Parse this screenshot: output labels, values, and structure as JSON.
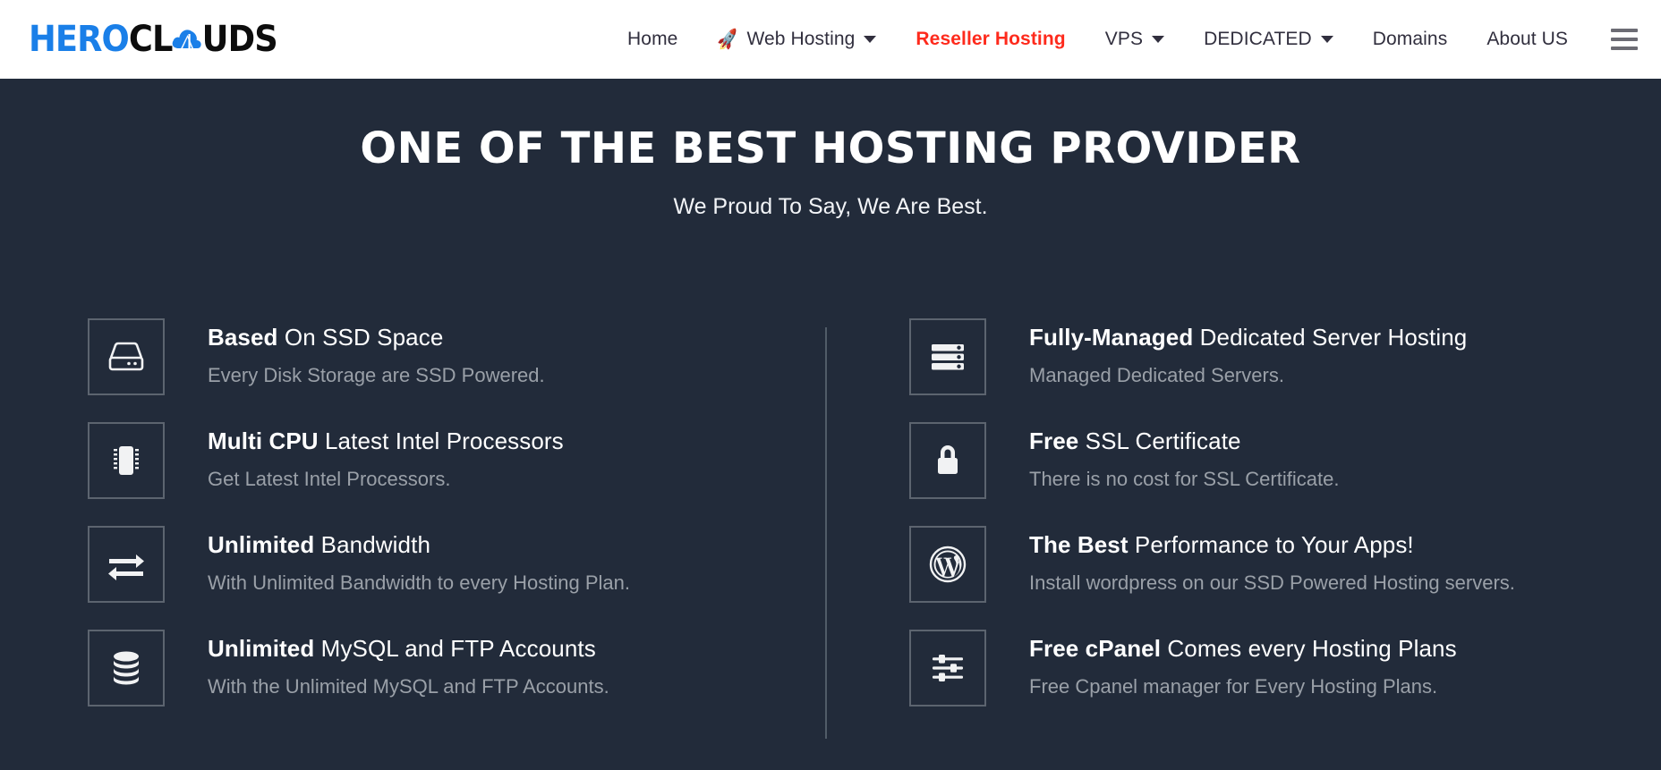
{
  "brand": {
    "name_part1": "HERO",
    "name_part2": "CL",
    "name_part3": "UDS",
    "color_primary": "#1a7fe8",
    "color_secondary": "#0d0d0d"
  },
  "nav": {
    "items": [
      {
        "label": "Home",
        "has_caret": false,
        "icon": null,
        "active": false
      },
      {
        "label": "Web Hosting",
        "has_caret": true,
        "icon": "rocket-icon",
        "active": false
      },
      {
        "label": "Reseller Hosting",
        "has_caret": false,
        "icon": null,
        "active": true
      },
      {
        "label": "VPS",
        "has_caret": true,
        "icon": null,
        "active": false
      },
      {
        "label": "DEDICATED",
        "has_caret": true,
        "icon": null,
        "active": false
      },
      {
        "label": "Domains",
        "has_caret": false,
        "icon": null,
        "active": false
      },
      {
        "label": "About US",
        "has_caret": false,
        "icon": null,
        "active": false
      }
    ],
    "active_color": "#fe2a1c",
    "menu_icon": "hamburger-menu-icon"
  },
  "hero": {
    "title": "ONE OF THE BEST HOSTING PROVIDER",
    "subtitle": "We Proud To Say, We Are Best.",
    "background_color": "#222b3a"
  },
  "features": {
    "left": [
      {
        "icon": "hard-drive-icon",
        "title_bold": "Based",
        "title_rest": " On SSD Space",
        "description": "Every Disk Storage are SSD Powered."
      },
      {
        "icon": "cpu-chip-icon",
        "title_bold": "Multi CPU",
        "title_rest": " Latest Intel Processors",
        "description": "Get Latest Intel Processors."
      },
      {
        "icon": "exchange-arrows-icon",
        "title_bold": "Unlimited",
        "title_rest": " Bandwidth",
        "description": "With Unlimited Bandwidth to every Hosting Plan."
      },
      {
        "icon": "database-icon",
        "title_bold": "Unlimited",
        "title_rest": " MySQL and FTP Accounts",
        "description": "With the Unlimited MySQL and FTP Accounts."
      }
    ],
    "right": [
      {
        "icon": "server-rack-icon",
        "title_bold": "Fully-Managed",
        "title_rest": " Dedicated Server Hosting",
        "description": "Managed Dedicated Servers."
      },
      {
        "icon": "lock-icon",
        "title_bold": "Free",
        "title_rest": " SSL Certificate",
        "description": "There is no cost for SSL Certificate."
      },
      {
        "icon": "wordpress-icon",
        "title_bold": "The Best",
        "title_rest": " Performance to Your Apps!",
        "description": "Install wordpress on our SSD Powered Hosting servers."
      },
      {
        "icon": "sliders-icon",
        "title_bold": "Free cPanel",
        "title_rest": " Comes every Hosting Plans",
        "description": "Free Cpanel manager for Every Hosting Plans."
      }
    ]
  }
}
